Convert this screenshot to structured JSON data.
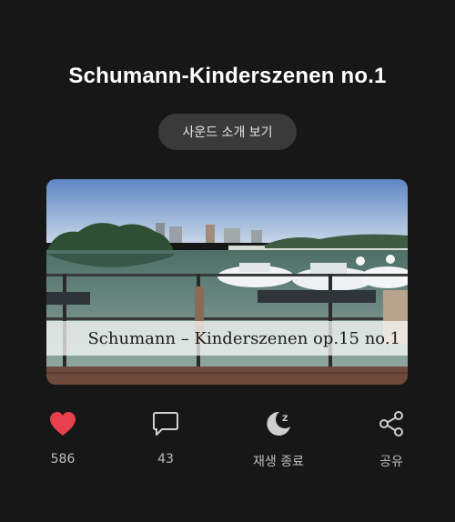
{
  "track": {
    "title": "Schumann-Kinderszenen no.1",
    "intro_button": "사운드 소개 보기",
    "thumbnail_caption": "Schumann – Kinderszenen op.15 no.1"
  },
  "actions": {
    "like": {
      "count": "586",
      "icon": "heart-icon",
      "color": "#e8404f"
    },
    "comments": {
      "count": "43",
      "icon": "chat-bubble-icon"
    },
    "sleep_timer": {
      "label": "재생 종료",
      "icon": "moon-sleep-icon"
    },
    "share": {
      "label": "공유",
      "icon": "share-icon"
    }
  }
}
